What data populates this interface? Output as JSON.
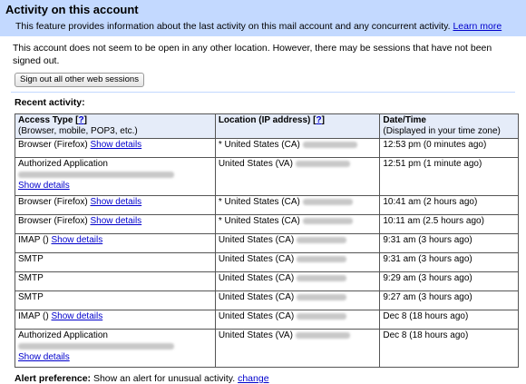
{
  "header": {
    "title": "Activity on this account",
    "info_text": "This feature provides information about the last activity on this mail account and any concurrent activity.",
    "learn_more": "Learn more"
  },
  "status_text": "This account does not seem to be open in any other location. However, there may be sessions that have not been signed out.",
  "signout_button": "Sign out all other web sessions",
  "recent_activity_title": "Recent activity:",
  "table": {
    "headers": {
      "access_type": "Access Type [",
      "help_q": "?",
      "access_type_end": "]",
      "access_type_sub": "(Browser, mobile, POP3, etc.)",
      "location": "Location (IP address) [",
      "location_end": "]",
      "datetime": "Date/Time",
      "datetime_sub": "(Displayed in your time zone)"
    },
    "rows": [
      {
        "type": "Browser (Firefox)",
        "link": "Show details",
        "location": "* United States (CA)",
        "time": "12:53 pm (0 minutes ago)"
      },
      {
        "type": "Authorized Application",
        "link": "Show details",
        "location": "United States (VA)",
        "time": "12:51 pm (1 minute ago)"
      },
      {
        "type": "Browser (Firefox)",
        "link": "Show details",
        "location": "* United States (CA)",
        "time": "10:41 am (2 hours ago)"
      },
      {
        "type": "Browser (Firefox)",
        "link": "Show details",
        "location": "* United States (CA)",
        "time": "10:11 am (2.5 hours ago)"
      },
      {
        "type": "IMAP ()",
        "link": "Show details",
        "location": "United States (CA)",
        "time": "9:31 am (3 hours ago)"
      },
      {
        "type": "SMTP",
        "link": "",
        "location": "United States (CA)",
        "time": "9:31 am (3 hours ago)"
      },
      {
        "type": "SMTP",
        "link": "",
        "location": "United States (CA)",
        "time": "9:29 am (3 hours ago)"
      },
      {
        "type": "SMTP",
        "link": "",
        "location": "United States (CA)",
        "time": "9:27 am (3 hours ago)"
      },
      {
        "type": "IMAP ()",
        "link": "Show details",
        "location": "United States (CA)",
        "time": "Dec 8 (18 hours ago)"
      },
      {
        "type": "Authorized Application",
        "link": "Show details",
        "location": "United States (VA)",
        "time": "Dec 8 (18 hours ago)"
      }
    ]
  },
  "alert": {
    "label": "Alert preference:",
    "text": "Show an alert for unusual activity.",
    "change": "change"
  },
  "colors": {
    "header_bg": "#c3d9ff",
    "link": "#0000cc",
    "table_header_bg": "#e5ecf9"
  }
}
